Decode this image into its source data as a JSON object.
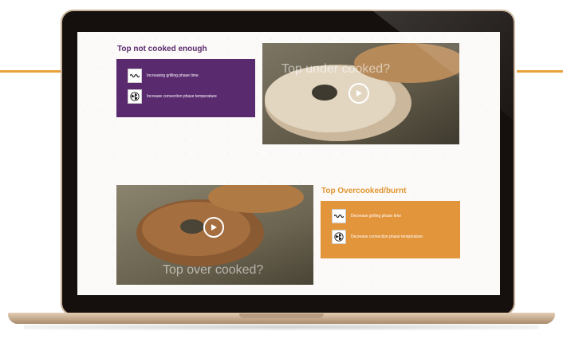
{
  "sections": {
    "not_cooked": {
      "title": "Top not cooked enough",
      "items": [
        {
          "label": "Increasing grilling phase time",
          "icon": "grill-icon"
        },
        {
          "label": "Increase convection phase temperature",
          "icon": "fan-icon"
        }
      ],
      "video_caption": "Top under cooked?"
    },
    "overcooked": {
      "title": "Top Overcooked/burnt",
      "items": [
        {
          "label": "Decrease grilling phase time",
          "icon": "grill-icon"
        },
        {
          "label": "Decrease convection phase temperature",
          "icon": "fan-icon"
        }
      ],
      "video_caption": "Top over cooked?"
    }
  },
  "colors": {
    "purple": "#5a2a6f",
    "orange": "#e3953c",
    "accent": "#e7a13c"
  }
}
